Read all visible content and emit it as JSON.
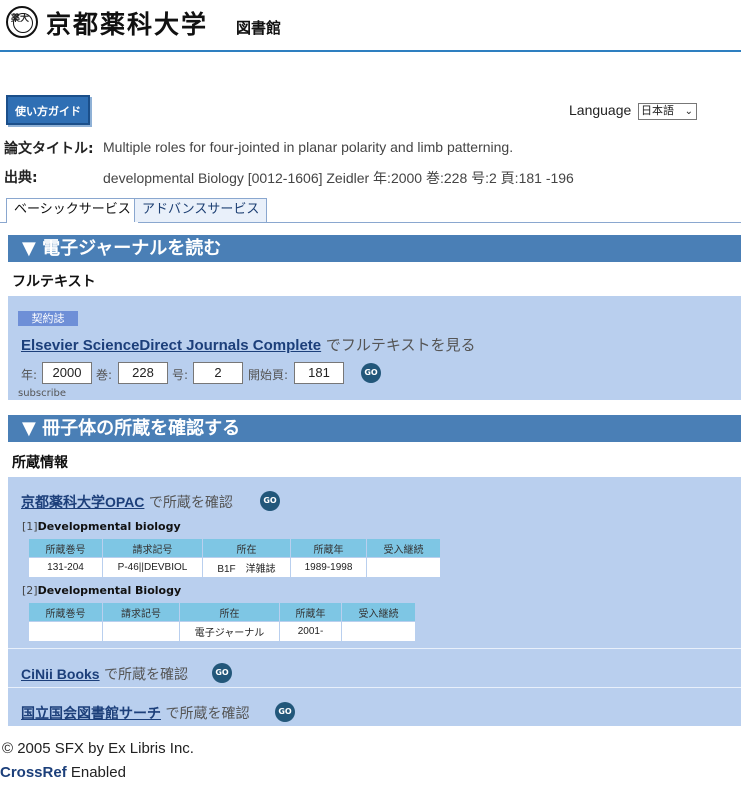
{
  "header": {
    "seal_text": "薬大",
    "university": "京都薬科大学",
    "library": "図書館"
  },
  "guide_button": "使い方ガイド",
  "language": {
    "label": "Language",
    "selected": "日本語"
  },
  "citation": {
    "title_label": "論文タイトル:",
    "title_value": "Multiple roles for four-jointed in planar polarity and limb patterning.",
    "source_label": "出典:",
    "source_value": "developmental Biology [0012-1606] Zeidler 年:2000 巻:228 号:2 頁:181 -196"
  },
  "tabs": [
    {
      "label": "ベーシックサービス",
      "active": true
    },
    {
      "label": "アドバンスサービス",
      "active": false
    }
  ],
  "ejournal": {
    "heading": "▼ 電子ジャーナルを読む",
    "subheading": "フルテキスト",
    "badge": "契約誌",
    "link": "Elsevier ScienceDirect Journals Complete",
    "link_suffix": "でフルテキストを見る",
    "fields": {
      "year_label": "年:",
      "year": "2000",
      "volume_label": "巻:",
      "volume": "228",
      "issue_label": "号:",
      "issue": "2",
      "start_label": "開始頁:",
      "start_page": "181"
    },
    "go": "GO",
    "note": "subscribe"
  },
  "holdings": {
    "heading": "▼ 冊子体の所蔵を確認する",
    "subheading": "所蔵情報",
    "opac_link": "京都薬科大学OPAC",
    "opac_suffix": "で所蔵を確認",
    "go": "GO",
    "columns": [
      "所蔵巻号",
      "請求記号",
      "所在",
      "所蔵年",
      "受入継続"
    ],
    "records": [
      {
        "index": "[1]",
        "title": "Developmental biology",
        "row": [
          "131-204",
          "P-46||DEVBIOL",
          "B1F　洋雑誌",
          "1989-1998",
          ""
        ]
      },
      {
        "index": "[2]",
        "title": "Developmental Biology",
        "row": [
          "",
          "",
          "電子ジャーナル",
          "2001-",
          ""
        ]
      }
    ],
    "cinii_link": "CiNii Books",
    "cinii_suffix": "で所蔵を確認",
    "ndl_link": "国立国会図書館サーチ",
    "ndl_suffix": "で所蔵を確認"
  },
  "footer": {
    "copyright": "© 2005 SFX by Ex Libris Inc.",
    "crossref": "CrossRef",
    "crossref_suffix": "Enabled"
  }
}
